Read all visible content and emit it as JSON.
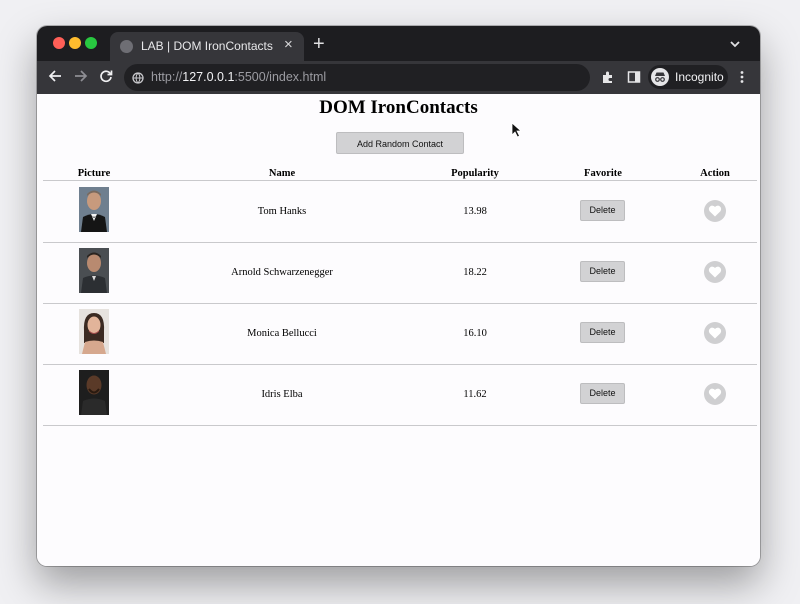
{
  "browser": {
    "tab_title": "LAB | DOM IronContacts",
    "tab_close": "×",
    "new_tab": "+",
    "url_scheme": "http://",
    "url_host": "127.0.0.1",
    "url_rest": ":5500/index.html",
    "profile_label": "Incognito"
  },
  "page": {
    "title": "DOM IronContacts",
    "add_button_label": "Add Random Contact"
  },
  "table": {
    "headers": [
      "Picture",
      "Name",
      "Popularity",
      "Favorite",
      "Action"
    ],
    "rows": [
      {
        "name": "Tom Hanks",
        "popularity": "13.98",
        "delete_label": "Delete"
      },
      {
        "name": "Arnold Schwarzenegger",
        "popularity": "18.22",
        "delete_label": "Delete"
      },
      {
        "name": "Monica Bellucci",
        "popularity": "16.10",
        "delete_label": "Delete"
      },
      {
        "name": "Idris Elba",
        "popularity": "11.62",
        "delete_label": "Delete"
      }
    ]
  },
  "icons": {
    "traffic_lights": [
      "close-light",
      "minimize-light",
      "zoom-light"
    ],
    "toolbar": [
      "back-arrow-icon",
      "forward-arrow-icon",
      "reload-icon",
      "site-info-icon",
      "extensions-icon",
      "side-panel-icon",
      "incognito-icon",
      "menu-kebab-icon"
    ],
    "row": [
      "contact-photo",
      "heart-icon"
    ]
  },
  "colors": {
    "tabbar_bg": "#1d1d20",
    "toolbar_bg": "#36363a",
    "page_bg": "#fdfcfe",
    "button_bg": "#d2d2d4",
    "heart_bg": "#cfcfd1"
  }
}
